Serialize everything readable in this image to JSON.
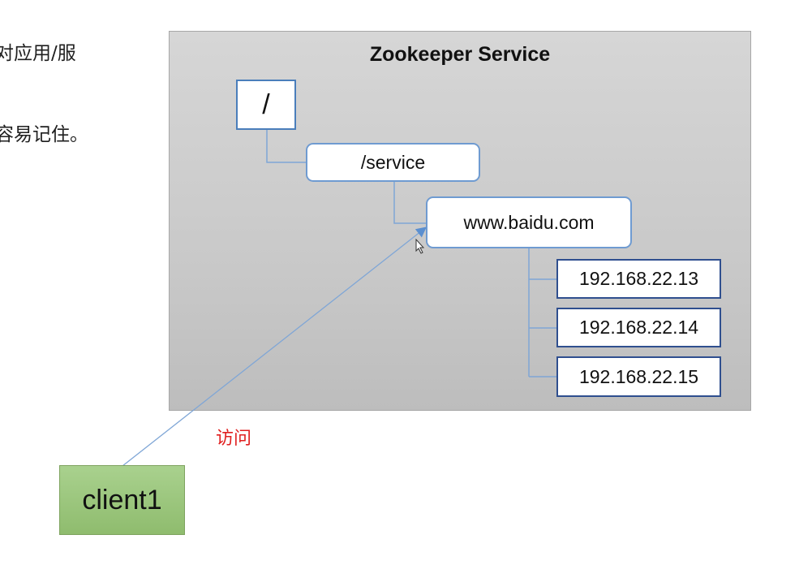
{
  "side_text": {
    "line1": "对应用/服",
    "line2": "容易记住。"
  },
  "service": {
    "title": "Zookeeper Service",
    "root_label": "/",
    "service_label": "/service",
    "domain_label": "www.baidu.com",
    "ips": [
      "192.168.22.13",
      "192.168.22.14",
      "192.168.22.15"
    ]
  },
  "client": {
    "label": "client1",
    "access_label": "访问"
  },
  "colors": {
    "node_border": "#4a7ebb",
    "connector": "#7fa6d6",
    "client_fill": "#a9d18e",
    "access_text": "#e02020"
  }
}
